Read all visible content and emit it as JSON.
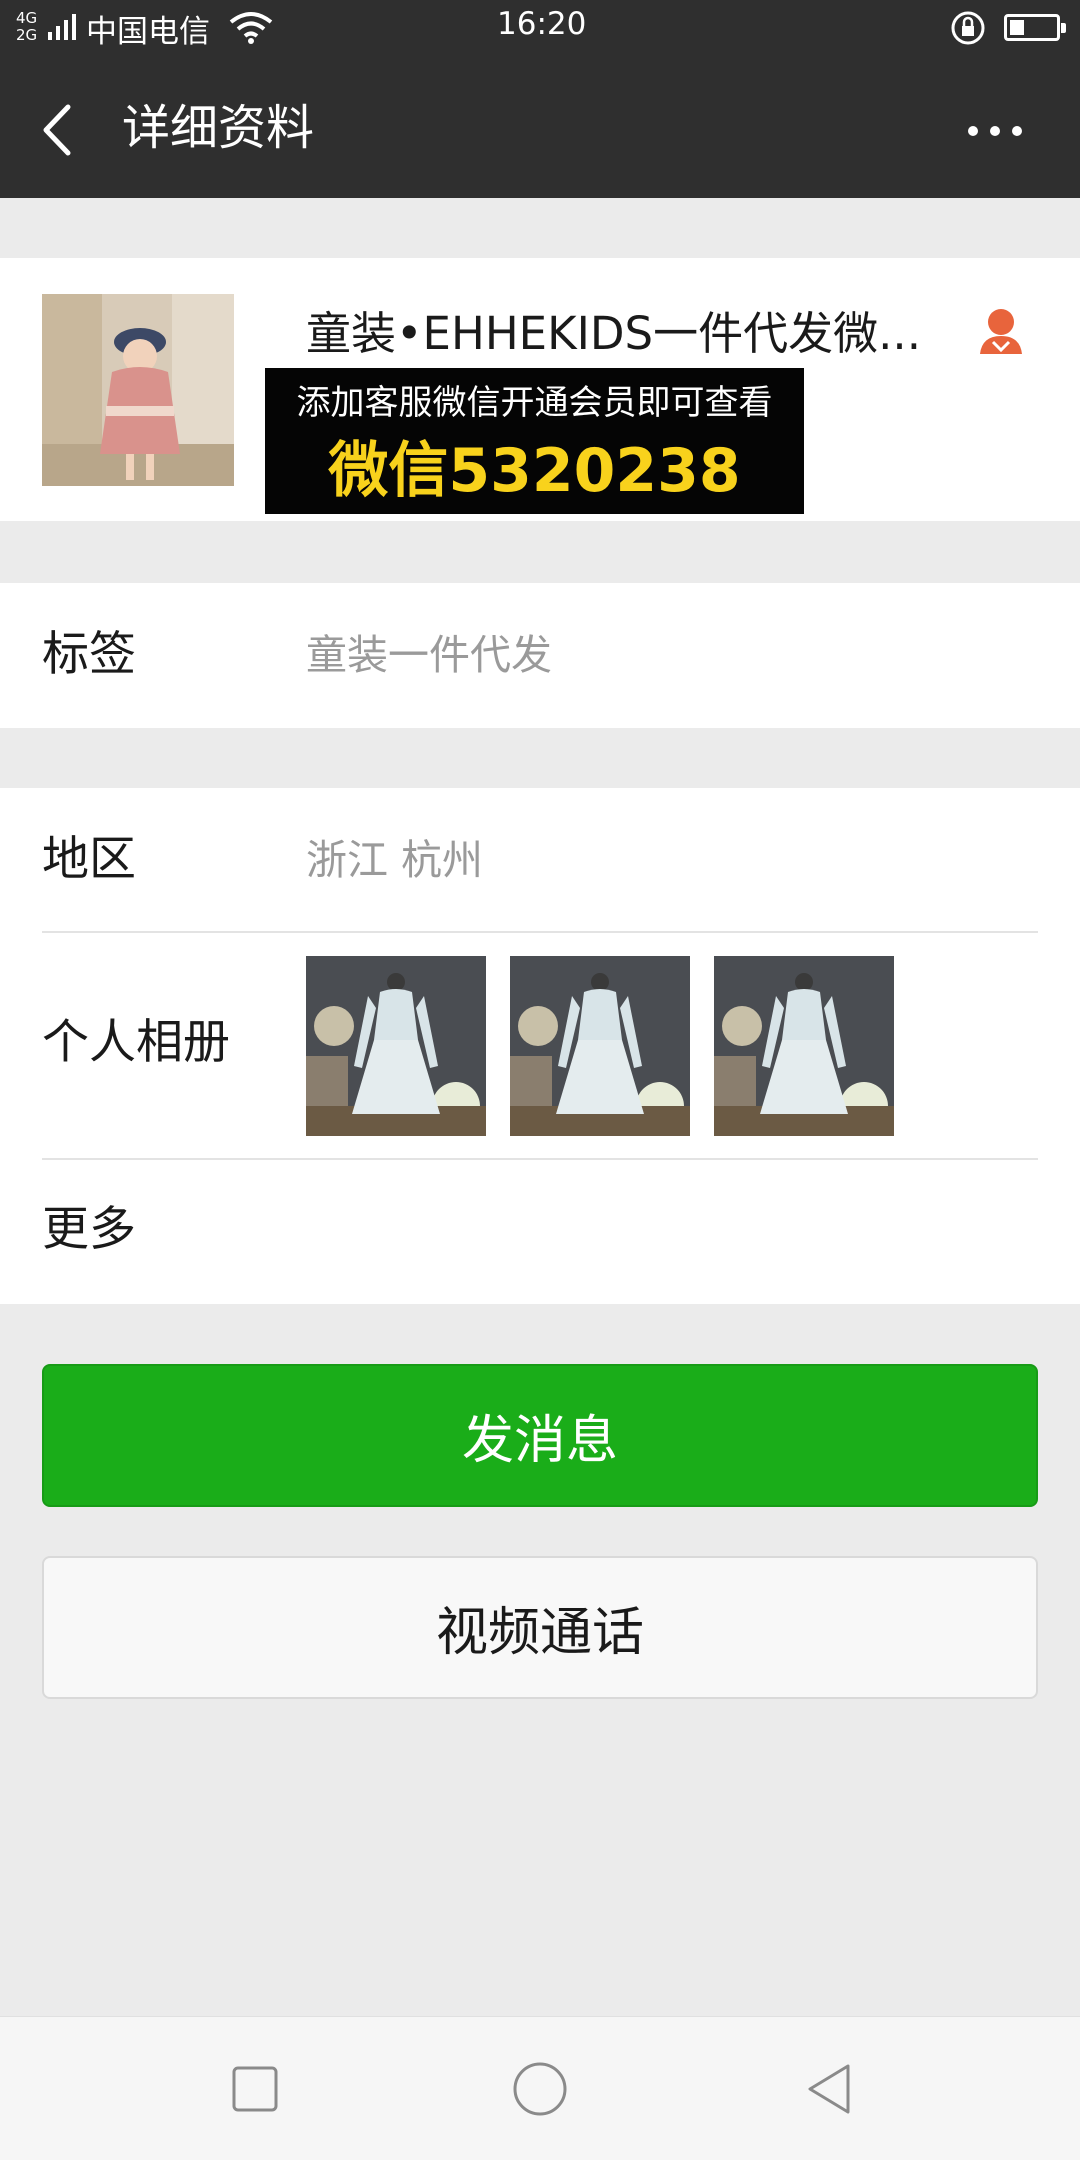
{
  "status_bar": {
    "network_type": "4G 2G",
    "carrier": "中国电信",
    "time": "16:20",
    "icons": [
      "signal-icon",
      "wifi-icon",
      "rotation-lock-icon",
      "battery-icon"
    ]
  },
  "header": {
    "title": "详细资料",
    "back_icon": "back-arrow-icon",
    "more_icon": "more-dots-icon"
  },
  "profile": {
    "display_name": "童装•EHHEKIDS一件代发微...",
    "gender_icon": "female-user-icon",
    "gender_color": "#e8643c",
    "promo_line1": "添加客服微信开通会员即可查看",
    "promo_line2": "微信5320238"
  },
  "tag_row": {
    "label": "标签",
    "value": "童装一件代发"
  },
  "region_row": {
    "label": "地区",
    "value": "浙江  杭州"
  },
  "album_row": {
    "label": "个人相册",
    "photo_count": 3
  },
  "more_row": {
    "label": "更多"
  },
  "actions": {
    "send_message": "发消息",
    "video_call": "视频通话",
    "primary_color": "#1aad19"
  },
  "nav_bar": {
    "icons": [
      "recent-apps-icon",
      "home-icon",
      "back-icon"
    ]
  }
}
